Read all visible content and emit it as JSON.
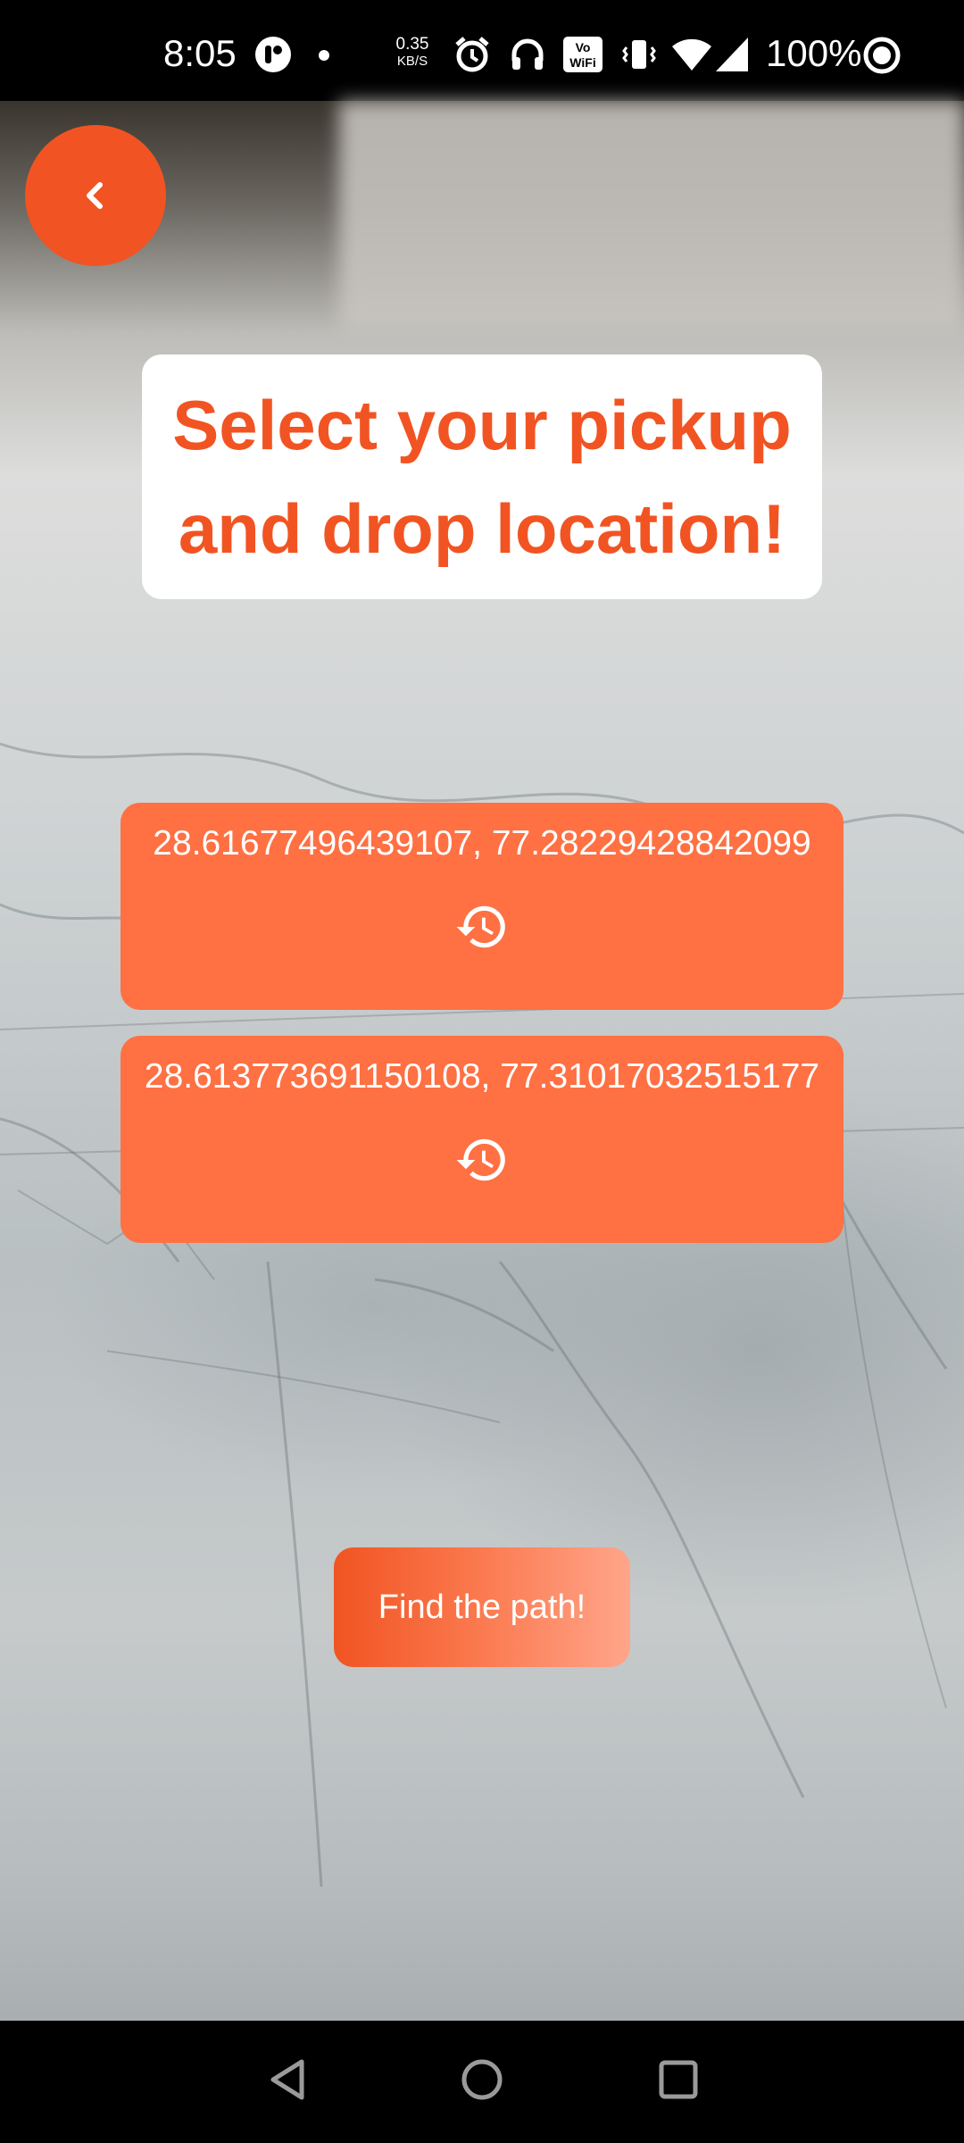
{
  "status_bar": {
    "time": "8:05",
    "network_speed_value": "0.35",
    "network_speed_unit": "KB/S",
    "battery_percent": "100%",
    "icons": [
      "app-notification-icon",
      "dot-icon",
      "alarm-icon",
      "headphones-icon",
      "vowifi-icon",
      "vibrate-icon",
      "wifi-icon",
      "signal-icon",
      "battery-saver-icon"
    ]
  },
  "header": {
    "back_icon": "chevron-left-icon"
  },
  "title": "Select your pickup and drop location!",
  "locations": {
    "pickup": {
      "coords": "28.61677496439107, 77.28229428842099",
      "icon": "history-icon"
    },
    "drop": {
      "coords": "28.613773691150108, 77.31017032515177",
      "icon": "history-icon"
    }
  },
  "find_button_label": "Find the path!",
  "colors": {
    "accent": "#f15422",
    "card": "#ff7043",
    "title_bg": "#ffffff"
  },
  "nav_bar": {
    "icons": [
      "back-triangle-icon",
      "home-circle-icon",
      "recents-square-icon"
    ]
  }
}
